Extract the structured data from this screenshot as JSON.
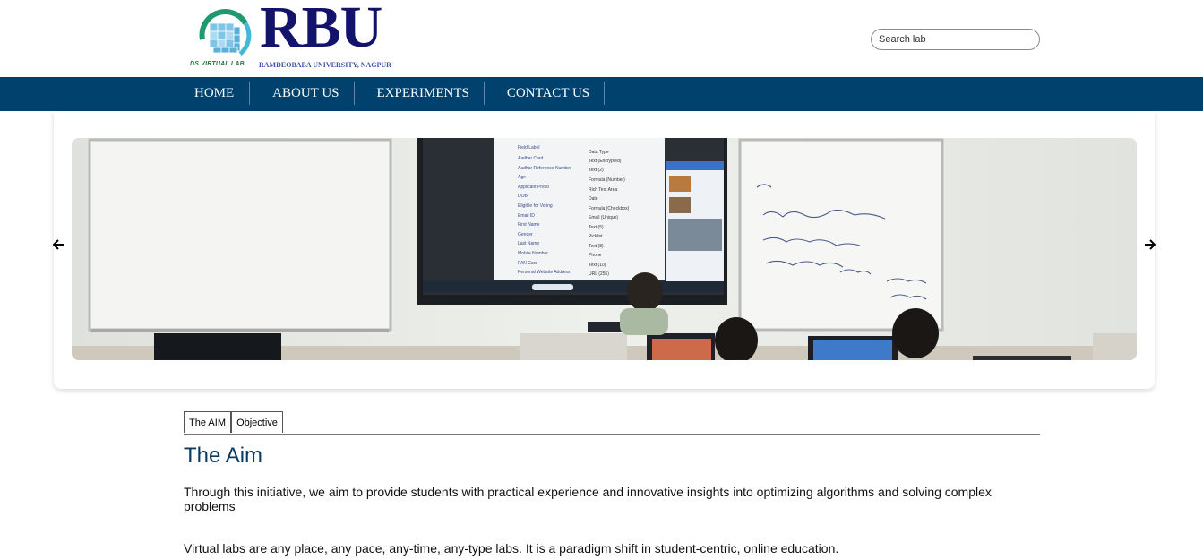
{
  "header": {
    "logo_title": "RBU",
    "logo_subtitle": "RAMDEOBABA UNIVERSITY, NAGPUR",
    "logo_tag": "DS VIRTUAL LAB",
    "search_placeholder": "Search lab"
  },
  "nav": {
    "items": [
      "HOME",
      "ABOUT US",
      "EXPERIMENTS",
      "CONTACT US"
    ]
  },
  "carousel": {
    "image": "classroom-photo",
    "prev_icon": "arrow-left-icon",
    "next_icon": "arrow-right-icon"
  },
  "tabs": {
    "items": [
      "The AIM",
      "Objective"
    ]
  },
  "content": {
    "heading": "The Aim",
    "para1": "Through this initiative, we aim to provide students with practical experience and innovative insights into optimizing algorithms and solving complex problems",
    "para2": "Virtual labs are any place, any pace, any-time, any-type labs. It is a paradigm shift in student-centric, online education."
  },
  "colors": {
    "nav_bg": "#00416d",
    "heading": "#0b3b63",
    "logo_text": "#13136b"
  }
}
